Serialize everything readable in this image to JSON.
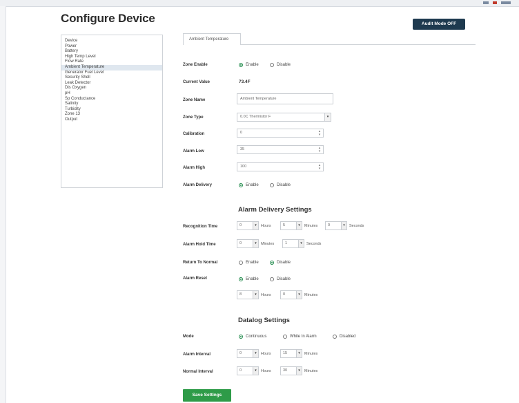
{
  "page_title": "Configure Device",
  "audit_button": "Audit Mode OFF",
  "sidebar": {
    "items": [
      {
        "label": "Device",
        "active": false
      },
      {
        "label": "Power",
        "active": false
      },
      {
        "label": "Battery",
        "active": false
      },
      {
        "label": "High Temp Level",
        "active": false
      },
      {
        "label": "Flow Rate",
        "active": false
      },
      {
        "label": "Ambient Temperature",
        "active": true
      },
      {
        "label": "Generator Fuel Level",
        "active": false
      },
      {
        "label": "Security Shell",
        "active": false
      },
      {
        "label": "Leak Detector",
        "active": false
      },
      {
        "label": "Dis Oxygen",
        "active": false
      },
      {
        "label": "pH",
        "active": false
      },
      {
        "label": "Sp Conductance",
        "active": false
      },
      {
        "label": "Salinity",
        "active": false
      },
      {
        "label": "Turbidity",
        "active": false
      },
      {
        "label": "Zone 13",
        "active": false
      },
      {
        "label": "Output",
        "active": false
      }
    ]
  },
  "tab": {
    "label": "Ambient Temperature"
  },
  "form": {
    "zone_enable": {
      "label": "Zone Enable",
      "opt1": "Enable",
      "opt2": "Disable",
      "selected": "Enable"
    },
    "current_value": {
      "label": "Current Value",
      "value": "73.4F"
    },
    "zone_name": {
      "label": "Zone Name",
      "value": "Ambient Temperature"
    },
    "zone_type": {
      "label": "Zone Type",
      "value": "0.0C Thermistor F"
    },
    "calibration": {
      "label": "Calibration",
      "value": "0"
    },
    "alarm_low": {
      "label": "Alarm Low",
      "value": "35"
    },
    "alarm_high": {
      "label": "Alarm High",
      "value": "100"
    },
    "alarm_delivery": {
      "label": "Alarm Delivery",
      "opt1": "Enable",
      "opt2": "Disable",
      "selected": "Enable"
    }
  },
  "alarm_settings": {
    "title": "Alarm Delivery Settings",
    "recognition_time": {
      "label": "Recognition Time",
      "hours": "0",
      "minutes": "5",
      "seconds": "0",
      "u_hours": "Hours",
      "u_minutes": "Minutes",
      "u_seconds": "Seconds"
    },
    "alarm_hold_time": {
      "label": "Alarm Hold Time",
      "minutes": "0",
      "seconds": "1",
      "u_minutes": "Minutes",
      "u_seconds": "Seconds"
    },
    "return_to_normal": {
      "label": "Return To Normal",
      "opt1": "Enable",
      "opt2": "Disable",
      "selected": "Disable"
    },
    "alarm_reset": {
      "label": "Alarm Reset",
      "opt1": "Enable",
      "opt2": "Disable",
      "selected": "Enable",
      "hours": "8",
      "minutes": "0",
      "u_hours": "Hours",
      "u_minutes": "Minutes"
    }
  },
  "datalog_settings": {
    "title": "Datalog Settings",
    "mode": {
      "label": "Mode",
      "opt1": "Continuous",
      "opt2": "While In Alarm",
      "opt3": "Disabled",
      "selected": "Continuous"
    },
    "alarm_interval": {
      "label": "Alarm Interval",
      "hours": "0",
      "minutes": "15",
      "u_hours": "Hours",
      "u_minutes": "Minutes"
    },
    "normal_interval": {
      "label": "Normal Interval",
      "hours": "0",
      "minutes": "30",
      "u_hours": "Hours",
      "u_minutes": "Minutes"
    }
  },
  "save_button": "Save Settings",
  "colors": {
    "accent_green": "#2e9b48",
    "audit_btn": "#1e3a4f",
    "radio_on": "#1f8a4a"
  }
}
